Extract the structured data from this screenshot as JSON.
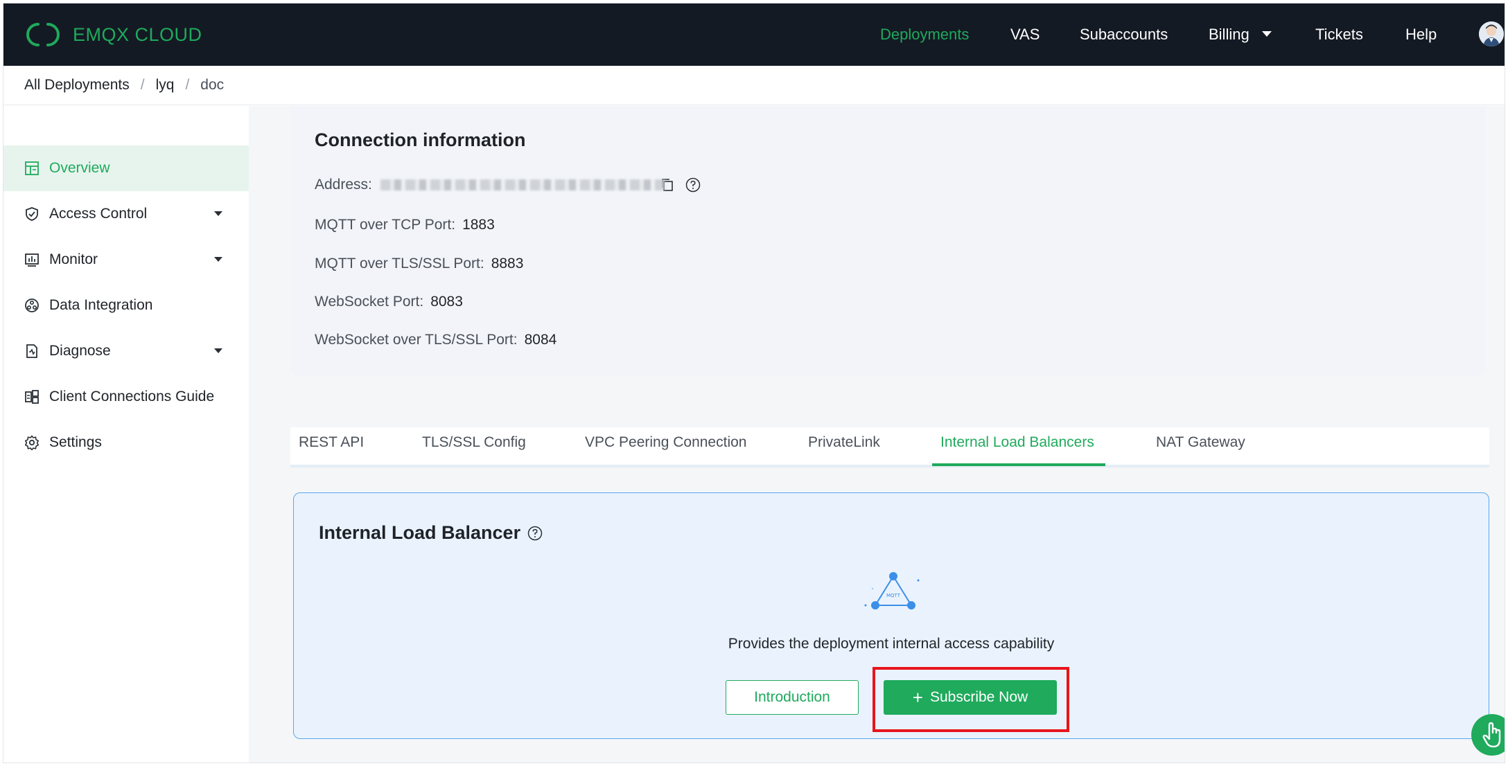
{
  "brand": {
    "name": "EMQX CLOUD",
    "color": "#1faa5c"
  },
  "nav": {
    "items": [
      {
        "label": "Deployments",
        "active": true
      },
      {
        "label": "VAS"
      },
      {
        "label": "Subaccounts"
      },
      {
        "label": "Billing",
        "dropdown": true
      },
      {
        "label": "Tickets"
      },
      {
        "label": "Help"
      }
    ],
    "avatar_icon": "user-avatar-icon"
  },
  "breadcrumb": [
    "All Deployments",
    "lyq",
    "doc"
  ],
  "sidebar": {
    "items": [
      {
        "label": "Overview",
        "icon": "dashboard-icon",
        "active": true
      },
      {
        "label": "Access Control",
        "icon": "shield-icon",
        "dropdown": true
      },
      {
        "label": "Monitor",
        "icon": "chart-icon",
        "dropdown": true
      },
      {
        "label": "Data Integration",
        "icon": "integration-icon"
      },
      {
        "label": "Diagnose",
        "icon": "diagnose-icon",
        "dropdown": true
      },
      {
        "label": "Client Connections Guide",
        "icon": "guide-icon"
      },
      {
        "label": "Settings",
        "icon": "gear-icon"
      }
    ]
  },
  "connection": {
    "title": "Connection information",
    "address_label": "Address:",
    "rows": [
      {
        "label": "MQTT over TCP Port:",
        "value": "1883"
      },
      {
        "label": "MQTT over TLS/SSL Port:",
        "value": "8883"
      },
      {
        "label": "WebSocket Port:",
        "value": "8083"
      },
      {
        "label": "WebSocket over TLS/SSL Port:",
        "value": "8084"
      }
    ]
  },
  "tabs": [
    {
      "label": "REST API"
    },
    {
      "label": "TLS/SSL Config"
    },
    {
      "label": "VPC Peering Connection"
    },
    {
      "label": "PrivateLink"
    },
    {
      "label": "Internal Load Balancers",
      "active": true
    },
    {
      "label": "NAT Gateway"
    }
  ],
  "ilb": {
    "title": "Internal Load Balancer",
    "illustration_text": "MQTT",
    "description": "Provides the deployment internal access capability",
    "intro_button": "Introduction",
    "subscribe_button": "Subscribe Now"
  },
  "colors": {
    "accent": "#1faa5c",
    "nav_bg": "#141a24",
    "highlight": "#e8141c",
    "card_bg": "#eaf3fd",
    "card_border": "#5aa7ee"
  }
}
